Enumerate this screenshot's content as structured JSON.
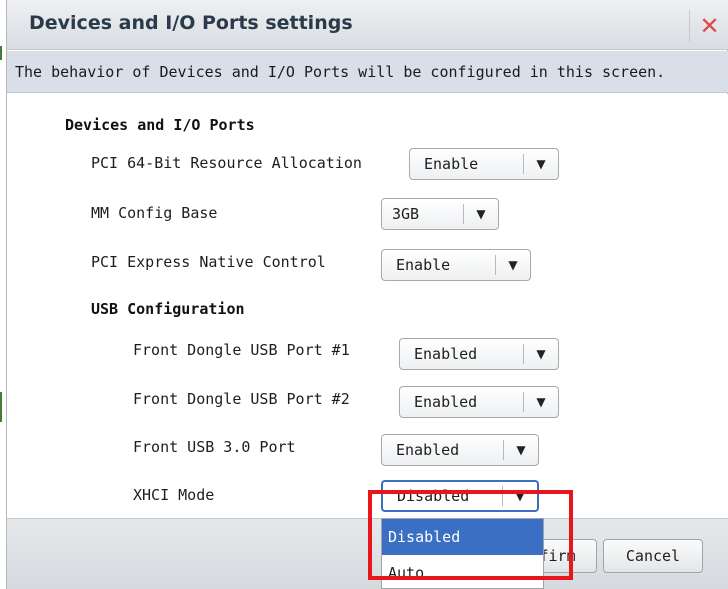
{
  "dialog": {
    "title": "Devices and I/O Ports settings",
    "close_glyph": "✕",
    "description": "The behavior of Devices and I/O Ports will be configured in this screen."
  },
  "sections": {
    "devices_heading": "Devices and I/O Ports",
    "usb_heading": "USB Configuration"
  },
  "settings": [
    {
      "label": "PCI 64-Bit Resource Allocation",
      "value": "Enable"
    },
    {
      "label": "MM Config Base",
      "value": "3GB"
    },
    {
      "label": "PCI Express Native Control",
      "value": "Enable"
    },
    {
      "label": "Front Dongle USB Port #1",
      "value": "Enabled"
    },
    {
      "label": "Front Dongle USB Port #2",
      "value": "Enabled"
    },
    {
      "label": "Front USB 3.0 Port",
      "value": "Enabled"
    },
    {
      "label": "XHCI Mode",
      "value": "Disabled"
    }
  ],
  "dropdown": {
    "options": [
      "Disabled",
      "Auto"
    ],
    "selected_index": 0
  },
  "footer": {
    "confirm_label": "Confirm",
    "cancel_label": "Cancel"
  },
  "icons": {
    "arrow": "▼"
  },
  "colors": {
    "accent": "#3a6fc4",
    "highlight": "#e8151b",
    "close": "#e04848"
  }
}
